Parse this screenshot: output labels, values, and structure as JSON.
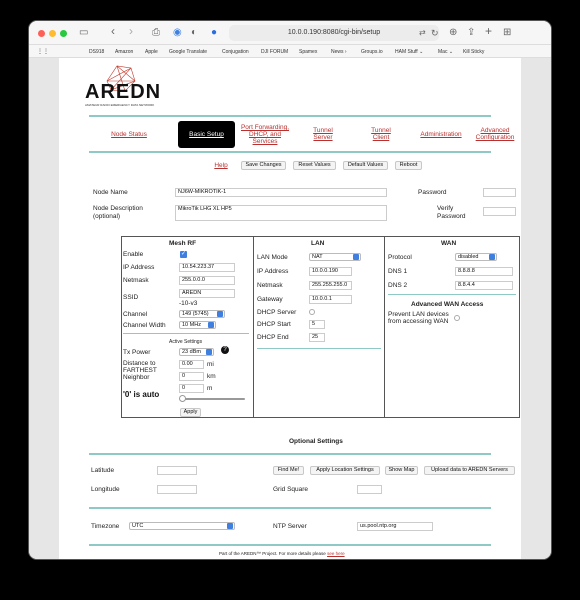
{
  "browser": {
    "url": "10.0.0.190:8080/cgi-bin/setup",
    "bookmarks": [
      "DS918",
      "Amazon",
      "Apple",
      "Google Translate",
      "Conjugation",
      "DJI FORUM",
      "Spamex",
      "News",
      "Groups.io",
      "HAM Stuff",
      "Mac",
      "Kill Sticky"
    ]
  },
  "logo": {
    "text": "AREDN",
    "tagline": "AMATEUR RADIO EMERGENCY DATA NETWORK"
  },
  "nav": {
    "node_status": "Node Status",
    "basic_setup": "Basic Setup",
    "port_fwd": [
      "Port Forwarding,",
      "DHCP, and",
      "Services"
    ],
    "tunnel_server": [
      "Tunnel",
      "Server"
    ],
    "tunnel_client": [
      "Tunnel",
      "Client"
    ],
    "administration": "Administration",
    "advanced": [
      "Advanced",
      "Configuration"
    ]
  },
  "actions": {
    "help": "Help",
    "save": "Save Changes",
    "reset": "Reset Values",
    "default": "Default Values",
    "reboot": "Reboot"
  },
  "node": {
    "name_label": "Node Name",
    "name_value": "NJ6W-MIKROTIK-1",
    "desc_label": [
      "Node Description",
      "(optional)"
    ],
    "desc_value": "MikroTik LHG XL HP5",
    "password_label": "Password",
    "verify_label": [
      "Verify",
      "Password"
    ]
  },
  "mesh": {
    "title": "Mesh RF",
    "enable": "Enable",
    "ip_label": "IP Address",
    "ip": "10.54.223.37",
    "netmask_label": "Netmask",
    "netmask": "255.0.0.0",
    "ssid_label": "SSID",
    "ssid": "AREDN",
    "ssid_suffix": "-10-v3",
    "channel_label": "Channel",
    "channel": "149 (5745)",
    "width_label": "Channel Width",
    "width": "10 MHz",
    "active": "Active Settings",
    "tx_label": "Tx Power",
    "tx": "23 dBm",
    "dist_label": [
      "Distance to",
      "FARTHEST",
      "Neighbor"
    ],
    "mi": "mi",
    "km": "km",
    "m": "m",
    "d1": "0.00",
    "d2": "0",
    "d3": "0",
    "auto": "'0' is auto",
    "apply": "Apply"
  },
  "lan": {
    "title": "LAN",
    "mode_label": "LAN Mode",
    "mode": "NAT",
    "ip_label": "IP Address",
    "ip": "10.0.0.190",
    "netmask_label": "Netmask",
    "netmask": "255.255.255.0",
    "gw_label": "Gateway",
    "gw": "10.0.0.1",
    "dhcp_label": "DHCP Server",
    "start_label": "DHCP Start",
    "start": "5",
    "end_label": "DHCP End",
    "end": "25"
  },
  "wan": {
    "title": "WAN",
    "proto_label": "Protocol",
    "proto": "disabled",
    "dns1_label": "DNS 1",
    "dns1": "8.8.8.8",
    "dns2_label": "DNS 2",
    "dns2": "8.8.4.4",
    "adv_title": "Advanced WAN Access",
    "prevent": [
      "Prevent LAN devices",
      "from accessing WAN"
    ]
  },
  "optional": {
    "title": "Optional Settings",
    "lat_label": "Latitude",
    "lon_label": "Longitude",
    "find": "Find Me!",
    "apply_loc": "Apply Location Settings",
    "show_map": "Show Map",
    "upload": "Upload data to AREDN Servers",
    "grid_label": "Grid Square",
    "tz_label": "Timezone",
    "tz": "UTC",
    "ntp_label": "NTP Server",
    "ntp": "us.pool.ntp.org"
  },
  "footer": {
    "text": "Part of the AREDN™ Project. For more details please",
    "link": "see here"
  }
}
